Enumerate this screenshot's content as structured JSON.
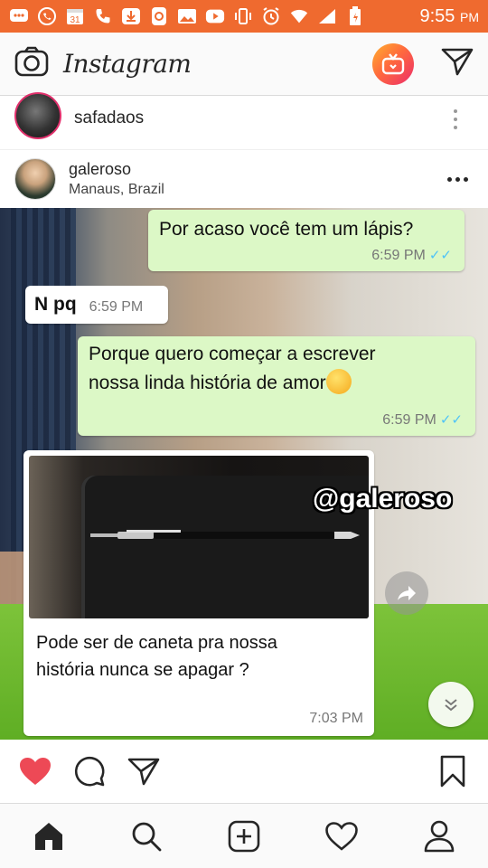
{
  "status_bar": {
    "time": "9:55",
    "ampm": "PM",
    "calendar_day": "31",
    "background_color": "#ef6a2f",
    "icons": [
      "messages-icon",
      "whatsapp-icon",
      "calendar-icon",
      "phone-icon",
      "download-icon",
      "phone-app-icon",
      "gallery-icon",
      "youtube-icon",
      "vibrate-icon",
      "alarm-icon",
      "wifi-icon",
      "signal-icon",
      "battery-icon"
    ]
  },
  "header": {
    "logo_text": "Instagram",
    "icons": [
      "camera-icon",
      "igtv-icon",
      "direct-message-icon"
    ]
  },
  "story": {
    "username": "safadaos"
  },
  "post": {
    "username": "galeroso",
    "location": "Manaus, Brazil",
    "image": {
      "watermark": "@galeroso",
      "messages": [
        {
          "direction": "outgoing",
          "text": "Por acaso você tem um lápis?",
          "time": "6:59 PM",
          "read": true
        },
        {
          "direction": "incoming",
          "text": "N pq",
          "time": "6:59 PM"
        },
        {
          "direction": "outgoing",
          "line1": "Porque quero começar a escrever",
          "line2": "nossa linda história de amor",
          "emoji": "blushing-face",
          "time": "6:59 PM",
          "read": true
        },
        {
          "direction": "incoming",
          "line1": "Pode ser de caneta pra nossa",
          "line2": "história nunca se apagar ?",
          "time": "7:03 PM",
          "has_photo": "pen-on-notebook"
        }
      ]
    },
    "actions": {
      "liked": true,
      "like_color": "#ed4956",
      "icons": [
        "heart-icon",
        "comment-icon",
        "share-icon",
        "bookmark-icon"
      ]
    }
  },
  "bottom_nav": {
    "items": [
      "home-icon",
      "search-icon",
      "add-post-icon",
      "activity-icon",
      "profile-icon"
    ],
    "active": "home-icon"
  }
}
